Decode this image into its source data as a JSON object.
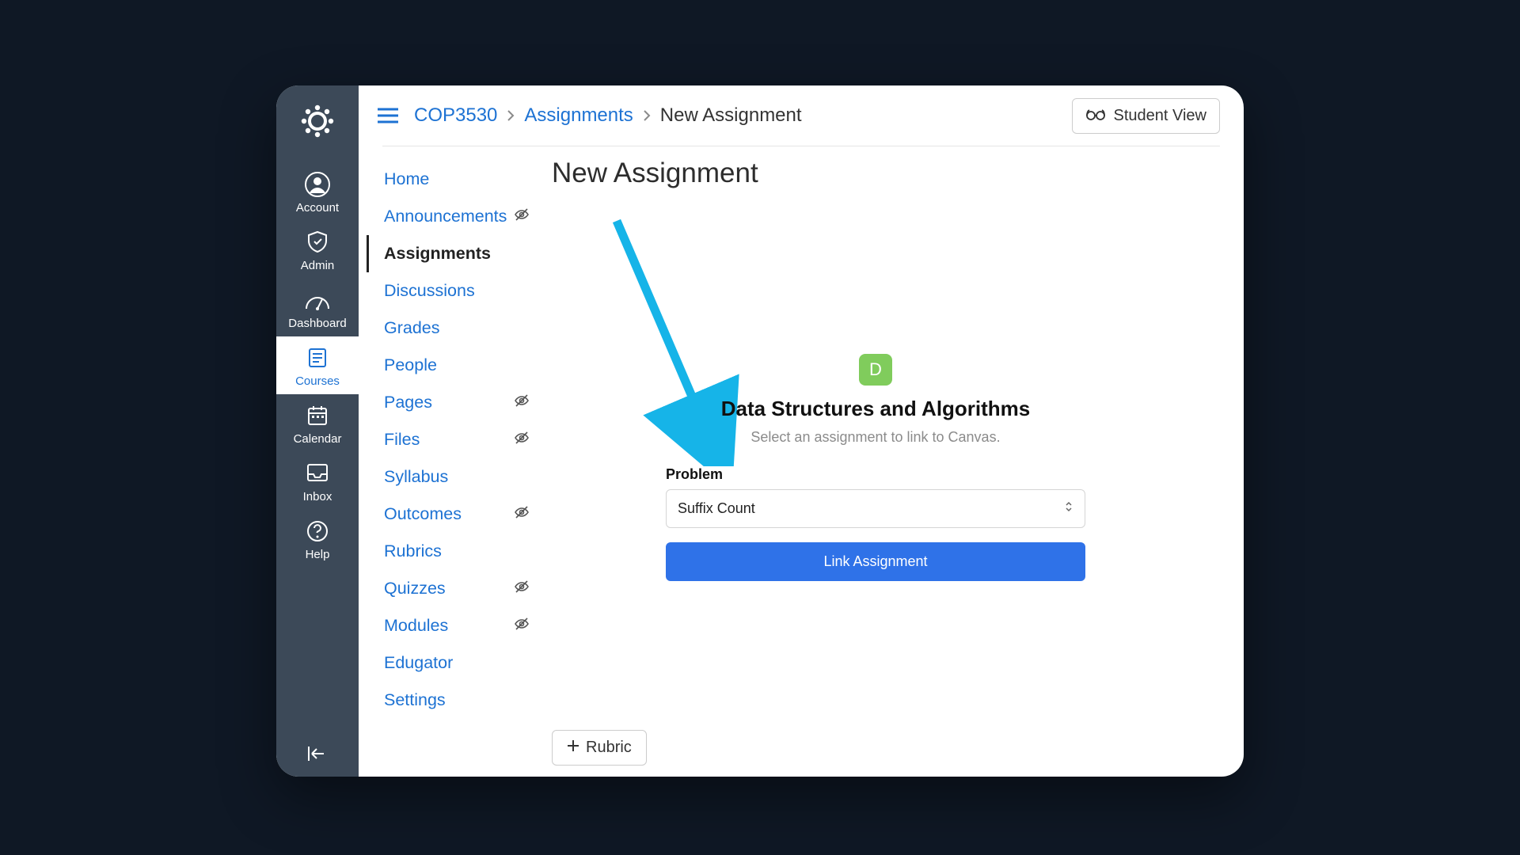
{
  "breadcrumb": {
    "course": "COP3530",
    "section": "Assignments",
    "current": "New Assignment"
  },
  "topbar": {
    "student_view_label": "Student View"
  },
  "global_nav": {
    "items": [
      {
        "label": "Account",
        "icon": "account-icon"
      },
      {
        "label": "Admin",
        "icon": "admin-icon"
      },
      {
        "label": "Dashboard",
        "icon": "dashboard-icon"
      },
      {
        "label": "Courses",
        "icon": "courses-icon",
        "active": true
      },
      {
        "label": "Calendar",
        "icon": "calendar-icon"
      },
      {
        "label": "Inbox",
        "icon": "inbox-icon"
      },
      {
        "label": "Help",
        "icon": "help-icon"
      }
    ]
  },
  "course_nav": {
    "items": [
      {
        "label": "Home"
      },
      {
        "label": "Announcements",
        "hidden": true
      },
      {
        "label": "Assignments",
        "active": true
      },
      {
        "label": "Discussions"
      },
      {
        "label": "Grades"
      },
      {
        "label": "People"
      },
      {
        "label": "Pages",
        "hidden": true
      },
      {
        "label": "Files",
        "hidden": true
      },
      {
        "label": "Syllabus"
      },
      {
        "label": "Outcomes",
        "hidden": true
      },
      {
        "label": "Rubrics"
      },
      {
        "label": "Quizzes",
        "hidden": true
      },
      {
        "label": "Modules",
        "hidden": true
      },
      {
        "label": "Edugator"
      },
      {
        "label": "Settings"
      }
    ]
  },
  "page": {
    "title": "New Assignment",
    "rubric_button": "Rubric"
  },
  "link_card": {
    "badge_letter": "D",
    "module_title": "Data Structures and Algorithms",
    "subtitle": "Select an assignment to link to Canvas.",
    "problem_label": "Problem",
    "selected_problem": "Suffix Count",
    "link_button": "Link Assignment"
  },
  "colors": {
    "accent_blue": "#1d72d3",
    "button_blue": "#2f72e8",
    "badge_green": "#80cc5c",
    "nav_bg": "#3c4958",
    "arrow": "#16b4e8"
  }
}
